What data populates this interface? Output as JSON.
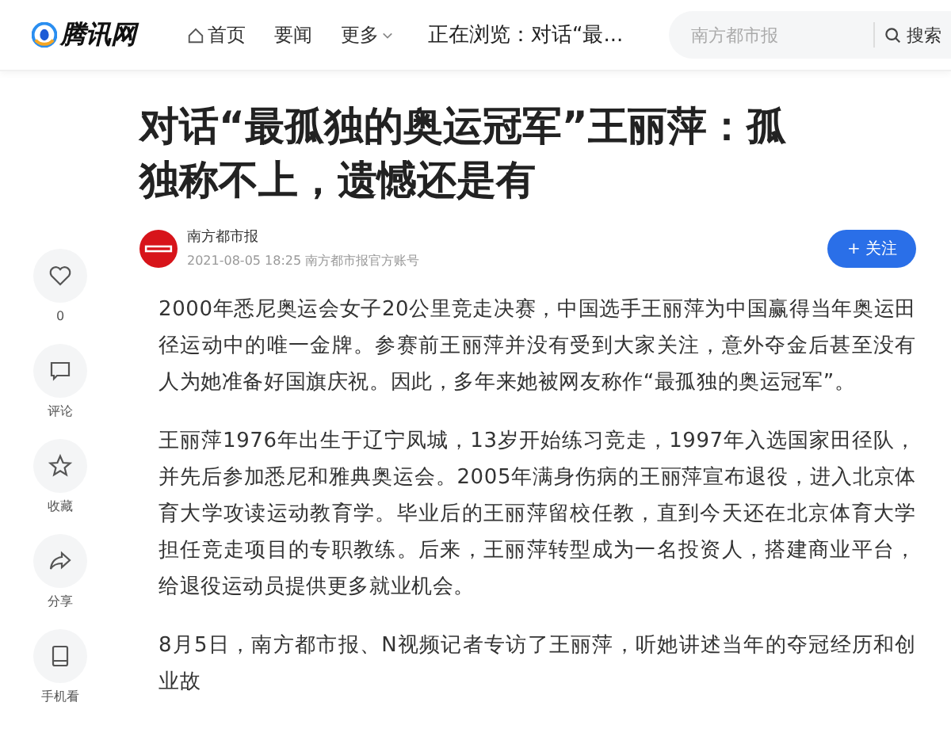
{
  "header": {
    "logo": "腾讯网",
    "nav": [
      {
        "label": "首页",
        "kind": "home"
      },
      {
        "label": "要闻",
        "kind": "plain"
      },
      {
        "label": "更多",
        "kind": "dropdown"
      }
    ],
    "browsing": "正在浏览：对话“最...",
    "search": {
      "placeholder": "南方都市报",
      "button": "搜索"
    }
  },
  "sidebar": [
    {
      "kind": "like",
      "label": "0"
    },
    {
      "kind": "comment",
      "label": "评论"
    },
    {
      "kind": "star",
      "label": "收藏"
    },
    {
      "kind": "share",
      "label": "分享"
    },
    {
      "kind": "phone",
      "label": "手机看"
    }
  ],
  "article": {
    "title": "对话“最孤独的奥运冠军”王丽萍：孤独称不上，遗憾还是有",
    "author": "南方都市报",
    "meta": "2021-08-05 18:25 南方都市报官方账号",
    "follow": "+ 关注",
    "paragraphs": [
      "2000年悉尼奥运会女子20公里竞走决赛，中国选手王丽萍为中国赢得当年奥运田径运动中的唯一金牌。参赛前王丽萍并没有受到大家关注，意外夺金后甚至没有人为她准备好国旗庆祝。因此，多年来她被网友称作“最孤独的奥运冠军”。",
      "王丽萍1976年出生于辽宁凤城，13岁开始练习竞走，1997年入选国家田径队，并先后参加悉尼和雅典奥运会。2005年满身伤病的王丽萍宣布退役，进入北京体育大学攻读运动教育学。毕业后的王丽萍留校任教，直到今天还在北京体育大学担任竞走项目的专职教练。后来，王丽萍转型成为一名投资人，搭建商业平台，给退役运动员提供更多就业机会。",
      "8月5日，南方都市报、N视频记者专访了王丽萍，听她讲述当年的夺冠经历和创业故"
    ]
  }
}
